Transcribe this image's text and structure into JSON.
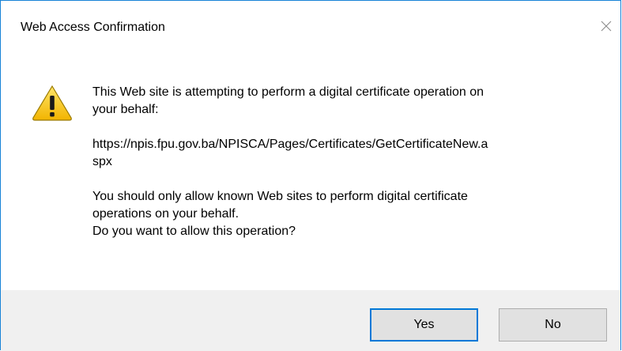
{
  "window": {
    "title": "Web Access Confirmation",
    "close_icon": "close-icon",
    "accent_color": "#1883d7"
  },
  "message": {
    "icon": "warning-icon",
    "paragraph1_line1": "This Web site is attempting to perform a digital certificate operation on",
    "paragraph1_line2": "your behalf:",
    "url_line1": "https://npis.fpu.gov.ba/NPISCA/Pages/Certificates/GetCertificateNew.a",
    "url_line2": "spx",
    "paragraph3_line1": "You should only allow known Web sites to perform digital certificate",
    "paragraph3_line2": "operations on your behalf.",
    "paragraph3_line3": "Do you want to allow this operation?"
  },
  "buttons": {
    "yes_label": "Yes",
    "no_label": "No"
  }
}
